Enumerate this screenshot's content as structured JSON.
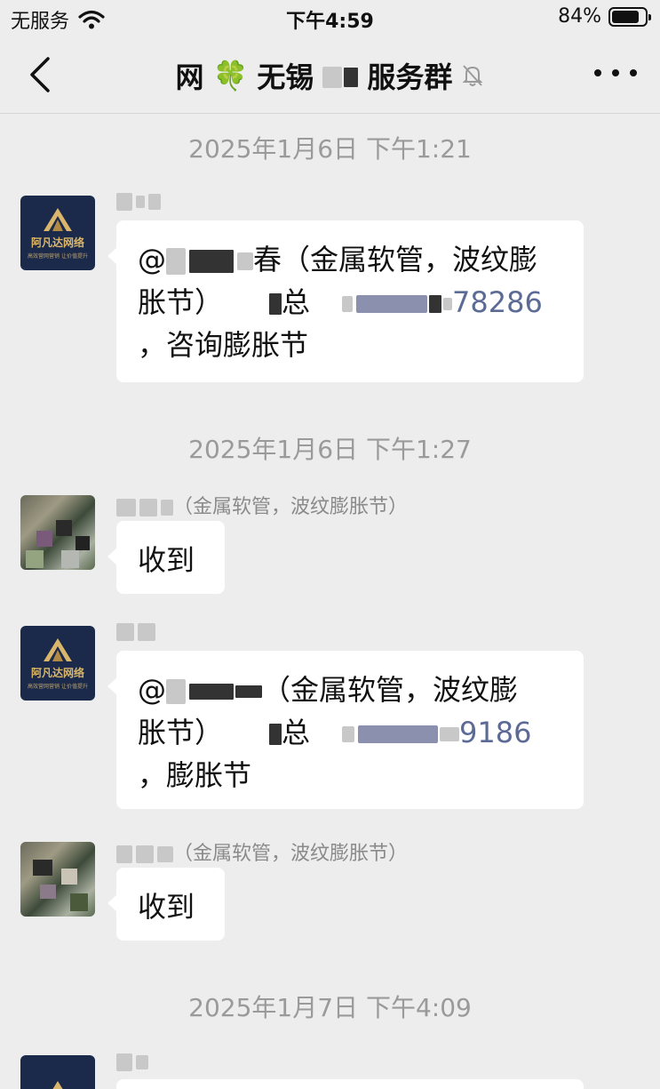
{
  "status_bar": {
    "carrier": "无服务",
    "time": "下午4:59",
    "battery_percent": "84%",
    "battery_level": 0.84
  },
  "nav": {
    "title_prefix": "网",
    "title_emoji": "🍀",
    "title_city": "无锡",
    "title_suffix": "服务群"
  },
  "brand_avatar": {
    "name": "阿凡达网络",
    "tagline": "高效营网营销 让价值提升"
  },
  "messages": [
    {
      "timestamp": "2025年1月6日 下午1:21",
      "line1_at": "@",
      "line1_end": "春（金属软管，波纹膨",
      "line2_start": "胀节）",
      "line2_mid": "总",
      "line2_phone_end": "78286",
      "line3": "，咨询膨胀节"
    },
    {
      "timestamp": "2025年1月6日 下午1:27",
      "sender_suffix": "（金属软管，波纹膨胀节）",
      "text": "收到"
    },
    {
      "line1_at": "@",
      "line1_end": "（金属软管，波纹膨",
      "line2_start": "胀节）",
      "line2_mid": "总",
      "line2_phone_end": "9186",
      "line3": "，膨胀节"
    },
    {
      "sender_suffix": "（金属软管，波纹膨胀节）",
      "text": "收到"
    },
    {
      "timestamp": "2025年1月7日 下午4:09"
    }
  ],
  "icons": {
    "wifi": "wifi-icon",
    "battery": "battery-icon",
    "back": "chevron-left-icon",
    "mute": "bell-slash-icon",
    "more": "more-dots-icon"
  },
  "colors": {
    "background": "#ededed",
    "bubble": "#ffffff",
    "phone_link": "#5b6b96",
    "timestamp": "#9a9a9a",
    "brand_navy": "#1b2a4a",
    "brand_gold": "#d9b66b"
  }
}
